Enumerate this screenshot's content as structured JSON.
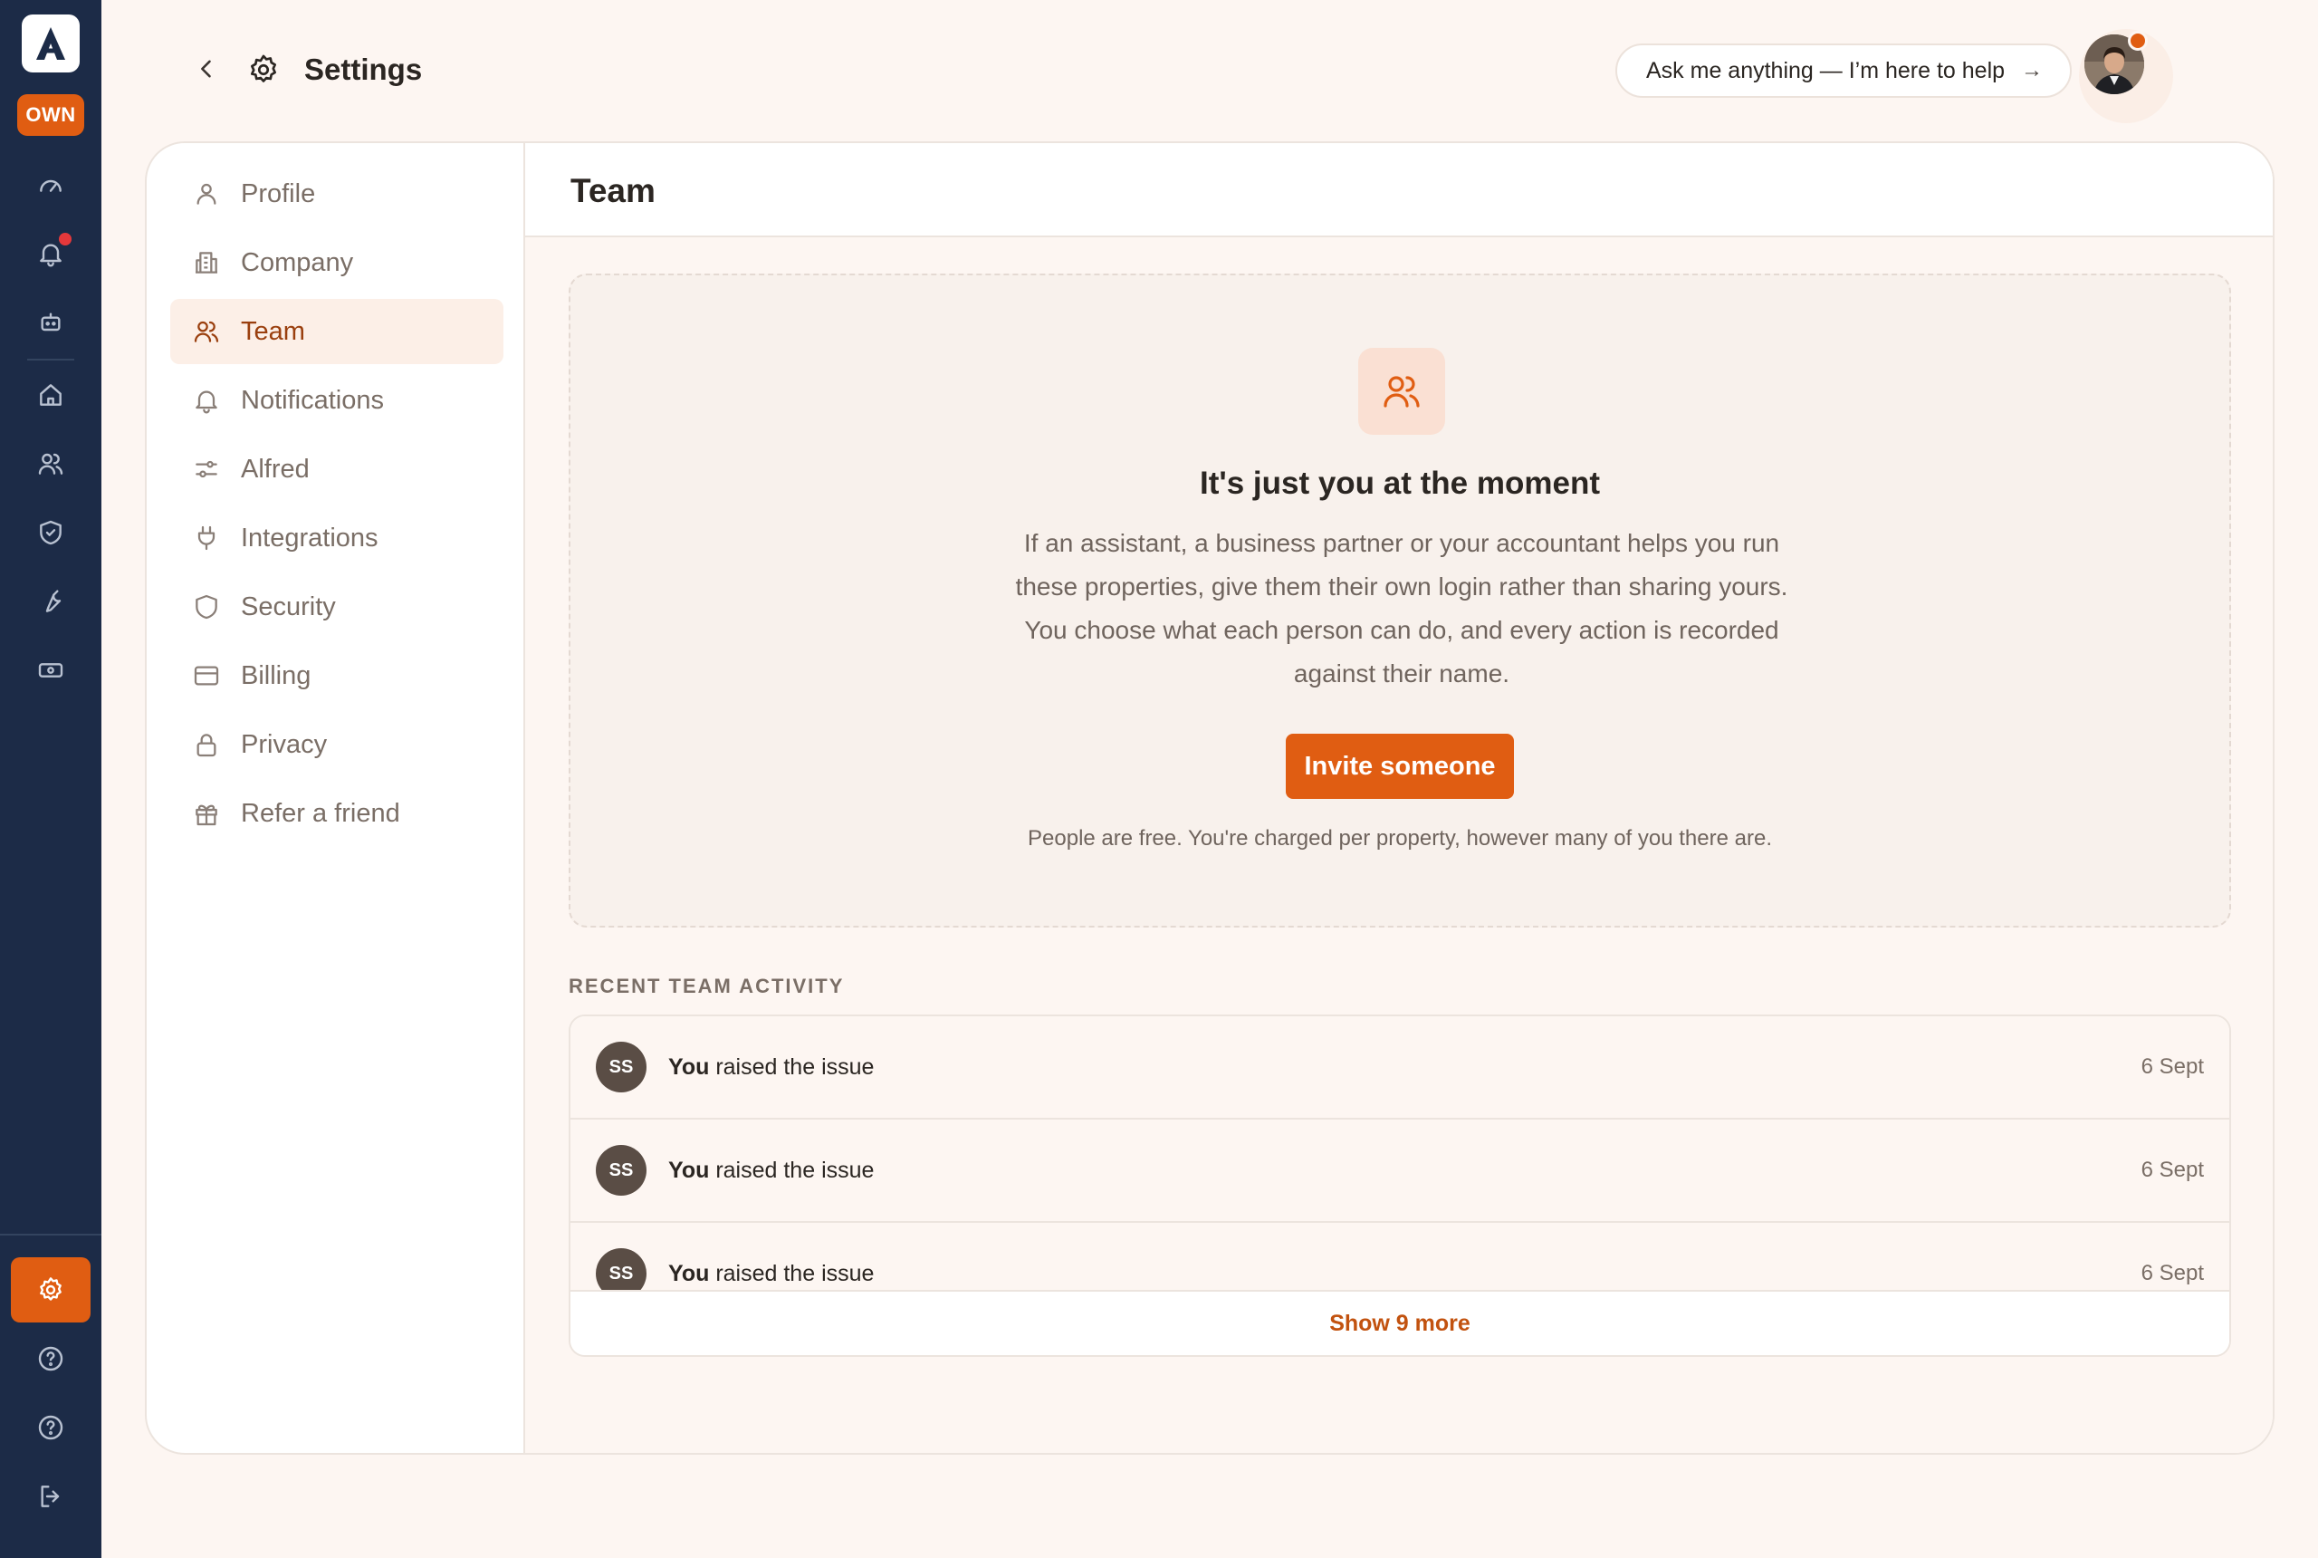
{
  "app": {
    "logo_letter": "A",
    "role_badge": "OWN",
    "accent_color": "#e05d12",
    "rail_color": "#1c2b47"
  },
  "rail": {
    "items": [
      {
        "icon": "dashboard-gauge-icon"
      },
      {
        "icon": "bell-icon",
        "has_notification": true
      },
      {
        "icon": "robot-icon"
      },
      {
        "icon": "home-icon"
      },
      {
        "icon": "people-icon"
      },
      {
        "icon": "shield-check-icon"
      },
      {
        "icon": "wrench-icon"
      },
      {
        "icon": "cash-icon"
      }
    ],
    "bottom": [
      {
        "icon": "settings-gear-icon",
        "active": true
      },
      {
        "icon": "help-circle-icon"
      },
      {
        "icon": "help-circle-icon"
      },
      {
        "icon": "logout-icon"
      }
    ]
  },
  "header": {
    "title": "Settings",
    "ask_placeholder": "Ask me anything — I’m here to help",
    "ask_arrow": "→"
  },
  "subnav": {
    "items": [
      {
        "label": "Profile",
        "icon": "user-icon"
      },
      {
        "label": "Company",
        "icon": "building-icon"
      },
      {
        "label": "Team",
        "icon": "team-icon",
        "active": true
      },
      {
        "label": "Notifications",
        "icon": "bell-icon"
      },
      {
        "label": "Alfred",
        "icon": "sliders-icon"
      },
      {
        "label": "Integrations",
        "icon": "plug-icon"
      },
      {
        "label": "Security",
        "icon": "shield-icon"
      },
      {
        "label": "Billing",
        "icon": "credit-card-icon"
      },
      {
        "label": "Privacy",
        "icon": "lock-icon"
      },
      {
        "label": "Refer a friend",
        "icon": "gift-icon"
      }
    ]
  },
  "content": {
    "title": "Team",
    "empty_state": {
      "icon": "team-icon",
      "title": "It's just you at the moment",
      "body": "If an assistant, a business partner or your accountant helps you run these properties, give them their own login rather than sharing yours. You choose what each person can do, and every action is recorded against their name.",
      "button": "Invite someone",
      "note": "People are free. You're charged per property, however many of you there are."
    },
    "activity": {
      "label": "RECENT TEAM ACTIVITY",
      "rows": [
        {
          "initials": "SS",
          "actor": "You",
          "action": "raised the issue",
          "date": "6 Sept"
        },
        {
          "initials": "SS",
          "actor": "You",
          "action": "raised the issue",
          "date": "6 Sept"
        },
        {
          "initials": "SS",
          "actor": "You",
          "action": "raised the issue",
          "date": "6 Sept"
        }
      ],
      "show_more": "Show 9 more"
    }
  }
}
